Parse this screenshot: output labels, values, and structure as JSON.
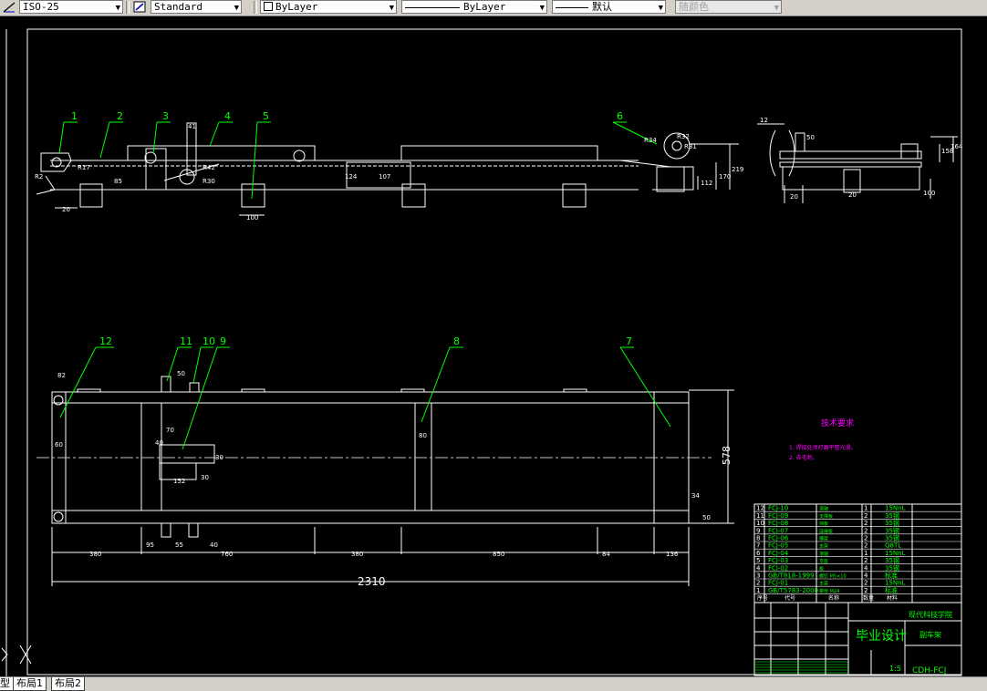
{
  "toolbar": {
    "dimstyle": "ISO-25",
    "textstyle": "Standard",
    "layer_color": "ByLayer",
    "linetype": "ByLayer",
    "lineweight": "默认",
    "plotstyle": "随颜色"
  },
  "tabs": [
    "型",
    "布局1",
    "布局2"
  ],
  "drawing": {
    "top_view_balloons": [
      "1",
      "2",
      "3",
      "4",
      "5",
      "6"
    ],
    "top_view_dims": [
      "R2",
      "R17",
      "20",
      "85",
      "41",
      "R42",
      "R30",
      "100",
      "124",
      "107",
      "R34",
      "R32",
      "R31",
      "112",
      "170",
      "219"
    ],
    "side_view_dims": [
      "12",
      "50",
      "158",
      "164",
      "20",
      "20",
      "100"
    ],
    "plan_balloons": [
      "12",
      "11",
      "10",
      "9",
      "8",
      "7"
    ],
    "plan_dims": [
      "82",
      "50",
      "60",
      "80",
      "70",
      "40",
      "30",
      "152",
      "30",
      "578",
      "34",
      "50",
      "80"
    ],
    "bottom_dims": [
      "380",
      "95",
      "55",
      "40",
      "760",
      "380",
      "850",
      "84",
      "136"
    ],
    "total_length": "2310",
    "tech_req_title": "技术要求",
    "tech_req_items": [
      "1. 焊接处须打磨平整光滑。",
      "2. 去毛刺。"
    ]
  },
  "bom": {
    "rows": [
      {
        "no": "12",
        "code": "FCJ-10",
        "name": "滚轴",
        "qty": "1",
        "material": "15NnL"
      },
      {
        "no": "11",
        "code": "FCJ-09",
        "name": "支撑板",
        "qty": "2",
        "material": "35钢"
      },
      {
        "no": "10",
        "code": "FCJ-08",
        "name": "挡板",
        "qty": "2",
        "material": "35钢"
      },
      {
        "no": "9",
        "code": "FCJ-07",
        "name": "连接板",
        "qty": "2",
        "material": "35钢"
      },
      {
        "no": "8",
        "code": "FCJ-06",
        "name": "横梁",
        "qty": "2",
        "material": "35钢"
      },
      {
        "no": "7",
        "code": "FCJ-05",
        "name": "支架",
        "qty": "2",
        "material": "Q8TL"
      },
      {
        "no": "6",
        "code": "FCJ-04",
        "name": "滚轴",
        "qty": "1",
        "material": "15NnL"
      },
      {
        "no": "5",
        "code": "FCJ-03",
        "name": "支座",
        "qty": "2",
        "material": "35钢"
      },
      {
        "no": "4",
        "code": "FCJ-02",
        "name": "板",
        "qty": "4",
        "material": "35钢"
      },
      {
        "no": "3",
        "code": "GB/T818-1999",
        "name": "螺钉 M5×10",
        "qty": "4",
        "material": "标准"
      },
      {
        "no": "2",
        "code": "FCJ-01",
        "name": "主梁",
        "qty": "2",
        "material": "15NnL"
      },
      {
        "no": "1",
        "code": "GB/T5783-2000",
        "name": "螺栓 M24",
        "qty": "2",
        "material": "标准"
      }
    ],
    "header": {
      "no": "序号",
      "code": "代号",
      "name": "名称",
      "qty": "数量",
      "material": "材料"
    }
  },
  "title_block": {
    "project": "毕业设计",
    "school": "现代科技学院",
    "drawing_name": "副车架",
    "scale": "1:5",
    "drawing_no": "CDH-FCJ"
  },
  "colors": {
    "line": "#ffffff",
    "balloon": "#00ff00",
    "accent": "#ff00ff",
    "dashed": "#c0c0c0",
    "toolbar_bg": "#d4d0c8"
  }
}
